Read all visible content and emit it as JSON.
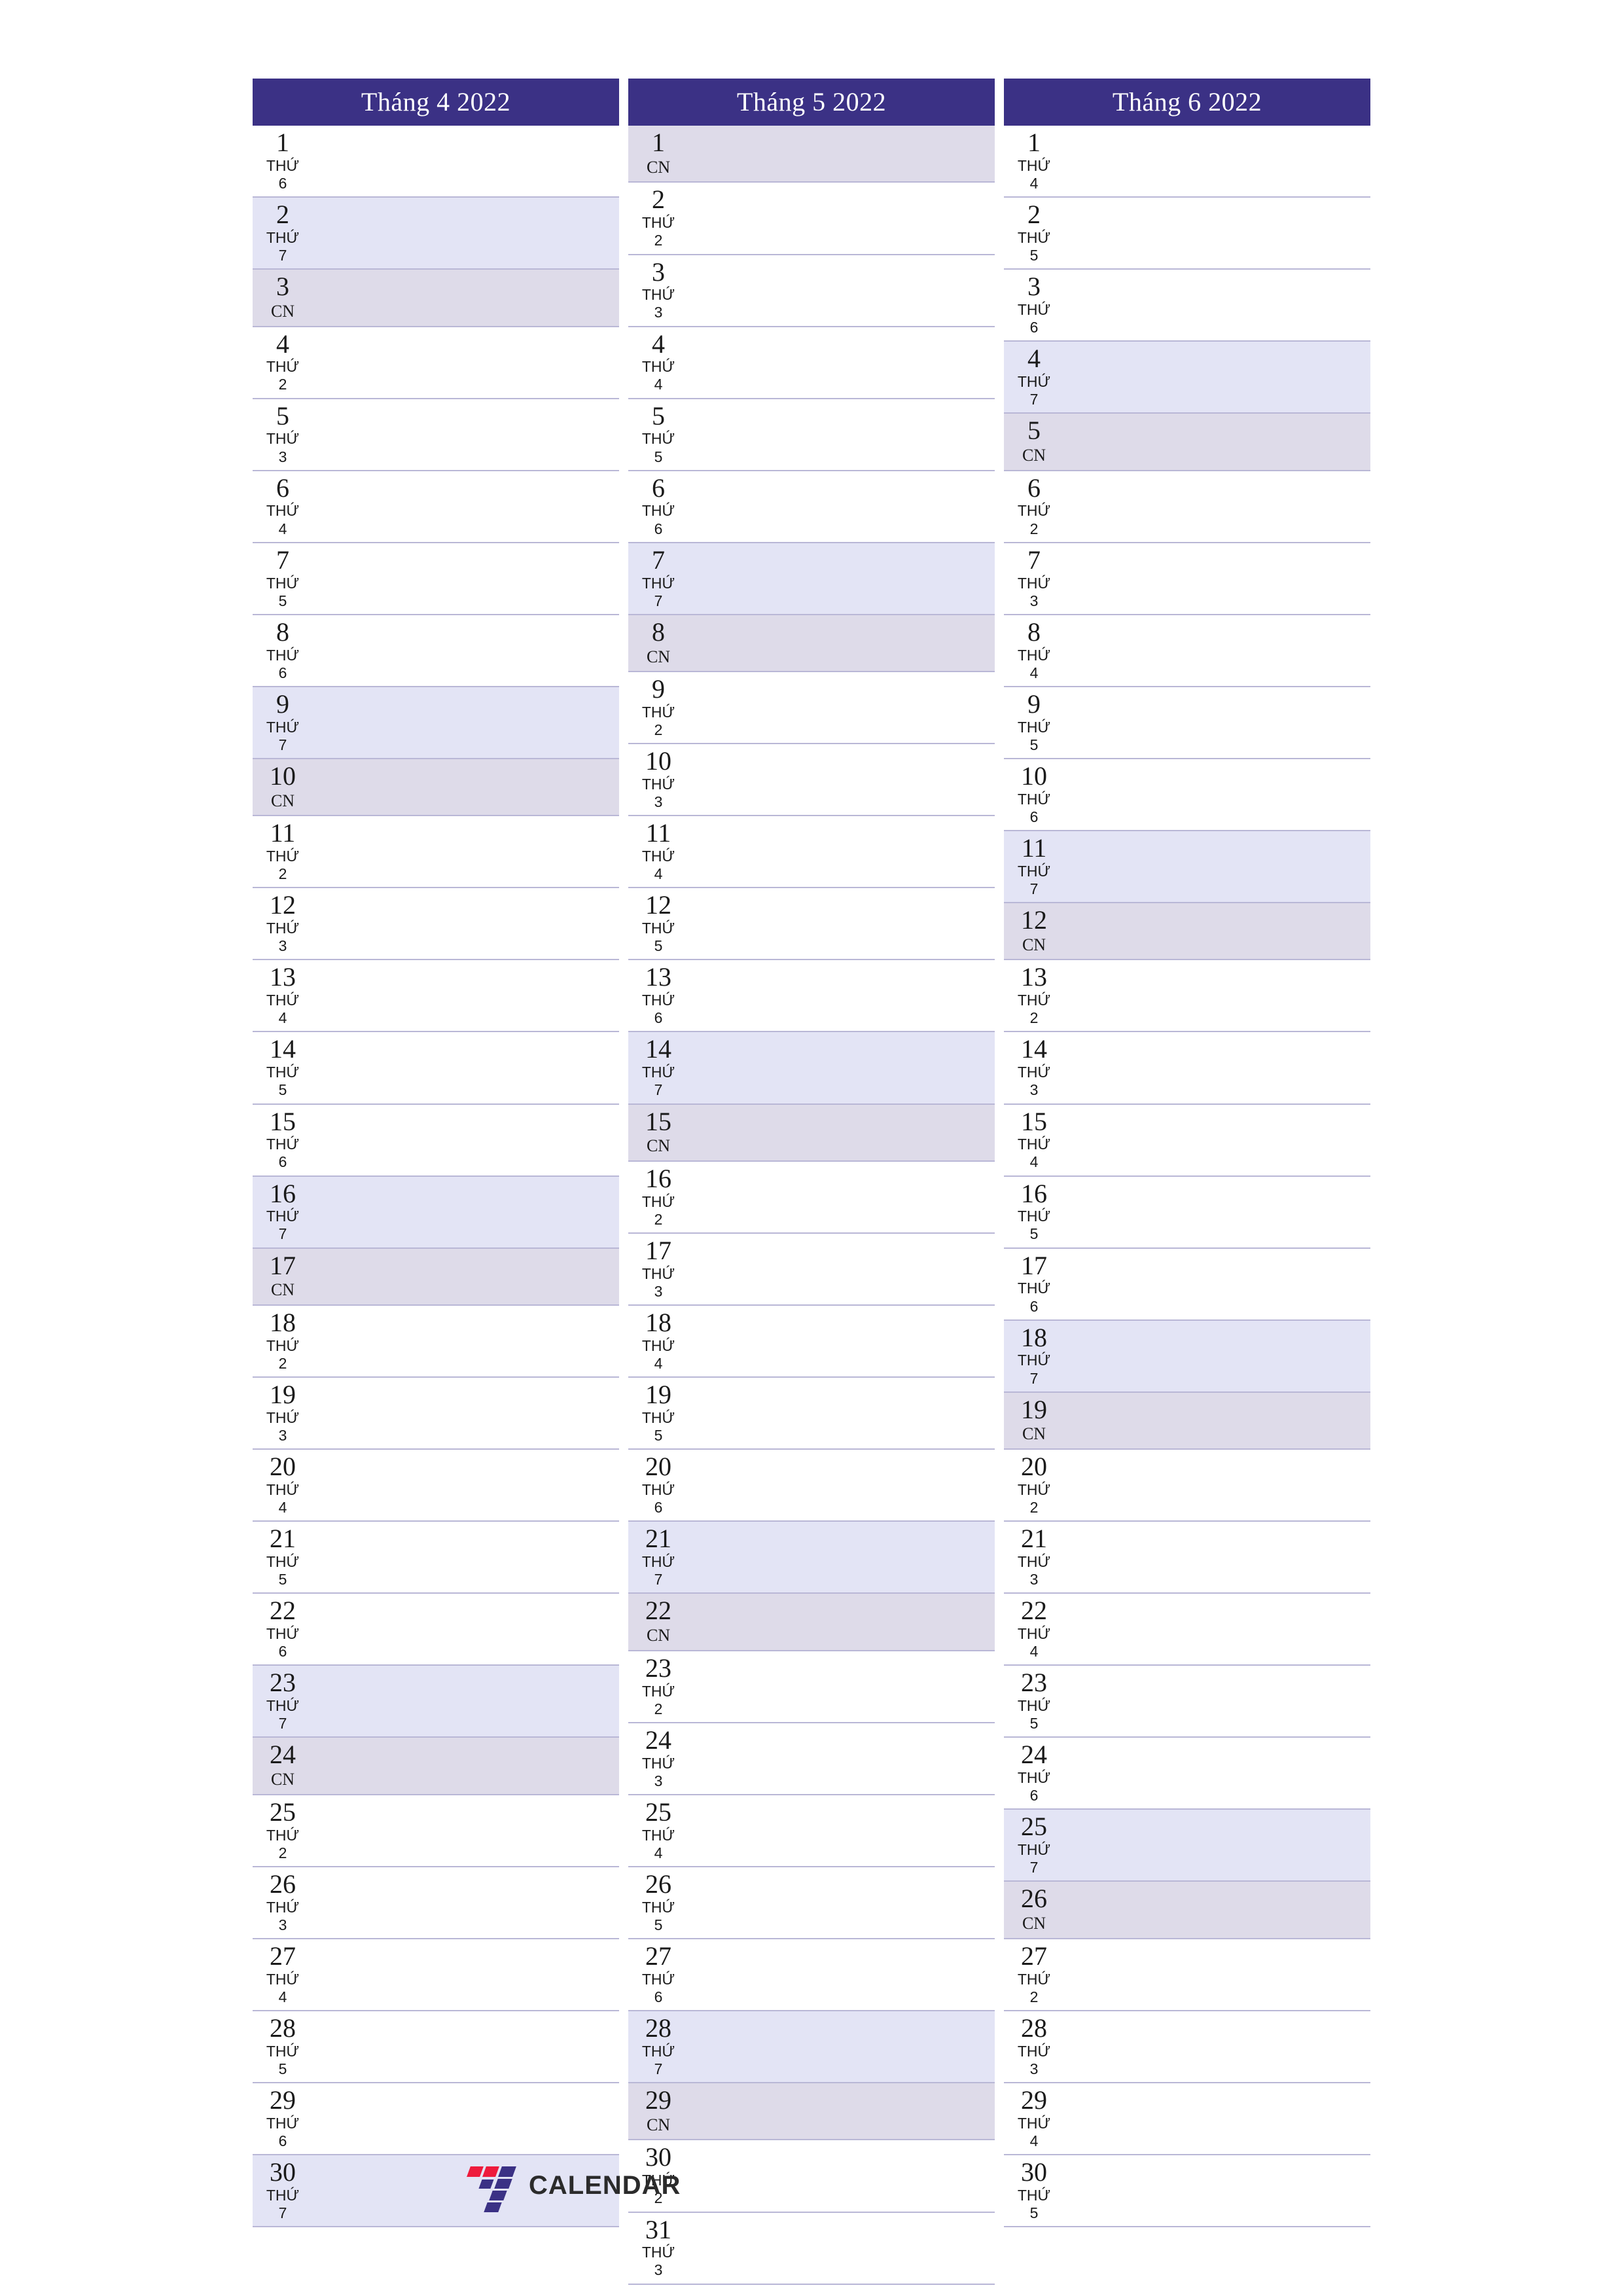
{
  "document": {
    "type": "quarterly-planner",
    "year": "2022",
    "weekend_colors": {
      "saturday": "#e3e4f5",
      "sunday": "#dedbe9"
    },
    "header_color": "#3b3185",
    "border_color": "#b9b7d6"
  },
  "brand": {
    "name": "CALENDAR",
    "mark": "seven-logo",
    "mark_colors": {
      "red": "#ee1b3c",
      "blue": "#3b3185"
    }
  },
  "months": [
    {
      "title": "Tháng 4 2022",
      "days": [
        {
          "num": "1",
          "name": "THỨ 6",
          "kind": "weekday"
        },
        {
          "num": "2",
          "name": "THỨ 7",
          "kind": "saturday"
        },
        {
          "num": "3",
          "name": "CN",
          "kind": "sunday"
        },
        {
          "num": "4",
          "name": "THỨ 2",
          "kind": "weekday"
        },
        {
          "num": "5",
          "name": "THỨ 3",
          "kind": "weekday"
        },
        {
          "num": "6",
          "name": "THỨ 4",
          "kind": "weekday"
        },
        {
          "num": "7",
          "name": "THỨ 5",
          "kind": "weekday"
        },
        {
          "num": "8",
          "name": "THỨ 6",
          "kind": "weekday"
        },
        {
          "num": "9",
          "name": "THỨ 7",
          "kind": "saturday"
        },
        {
          "num": "10",
          "name": "CN",
          "kind": "sunday"
        },
        {
          "num": "11",
          "name": "THỨ 2",
          "kind": "weekday"
        },
        {
          "num": "12",
          "name": "THỨ 3",
          "kind": "weekday"
        },
        {
          "num": "13",
          "name": "THỨ 4",
          "kind": "weekday"
        },
        {
          "num": "14",
          "name": "THỨ 5",
          "kind": "weekday"
        },
        {
          "num": "15",
          "name": "THỨ 6",
          "kind": "weekday"
        },
        {
          "num": "16",
          "name": "THỨ 7",
          "kind": "saturday"
        },
        {
          "num": "17",
          "name": "CN",
          "kind": "sunday"
        },
        {
          "num": "18",
          "name": "THỨ 2",
          "kind": "weekday"
        },
        {
          "num": "19",
          "name": "THỨ 3",
          "kind": "weekday"
        },
        {
          "num": "20",
          "name": "THỨ 4",
          "kind": "weekday"
        },
        {
          "num": "21",
          "name": "THỨ 5",
          "kind": "weekday"
        },
        {
          "num": "22",
          "name": "THỨ 6",
          "kind": "weekday"
        },
        {
          "num": "23",
          "name": "THỨ 7",
          "kind": "saturday"
        },
        {
          "num": "24",
          "name": "CN",
          "kind": "sunday"
        },
        {
          "num": "25",
          "name": "THỨ 2",
          "kind": "weekday"
        },
        {
          "num": "26",
          "name": "THỨ 3",
          "kind": "weekday"
        },
        {
          "num": "27",
          "name": "THỨ 4",
          "kind": "weekday"
        },
        {
          "num": "28",
          "name": "THỨ 5",
          "kind": "weekday"
        },
        {
          "num": "29",
          "name": "THỨ 6",
          "kind": "weekday"
        },
        {
          "num": "30",
          "name": "THỨ 7",
          "kind": "saturday"
        }
      ]
    },
    {
      "title": "Tháng 5 2022",
      "days": [
        {
          "num": "1",
          "name": "CN",
          "kind": "sunday"
        },
        {
          "num": "2",
          "name": "THỨ 2",
          "kind": "weekday"
        },
        {
          "num": "3",
          "name": "THỨ 3",
          "kind": "weekday"
        },
        {
          "num": "4",
          "name": "THỨ 4",
          "kind": "weekday"
        },
        {
          "num": "5",
          "name": "THỨ 5",
          "kind": "weekday"
        },
        {
          "num": "6",
          "name": "THỨ 6",
          "kind": "weekday"
        },
        {
          "num": "7",
          "name": "THỨ 7",
          "kind": "saturday"
        },
        {
          "num": "8",
          "name": "CN",
          "kind": "sunday"
        },
        {
          "num": "9",
          "name": "THỨ 2",
          "kind": "weekday"
        },
        {
          "num": "10",
          "name": "THỨ 3",
          "kind": "weekday"
        },
        {
          "num": "11",
          "name": "THỨ 4",
          "kind": "weekday"
        },
        {
          "num": "12",
          "name": "THỨ 5",
          "kind": "weekday"
        },
        {
          "num": "13",
          "name": "THỨ 6",
          "kind": "weekday"
        },
        {
          "num": "14",
          "name": "THỨ 7",
          "kind": "saturday"
        },
        {
          "num": "15",
          "name": "CN",
          "kind": "sunday"
        },
        {
          "num": "16",
          "name": "THỨ 2",
          "kind": "weekday"
        },
        {
          "num": "17",
          "name": "THỨ 3",
          "kind": "weekday"
        },
        {
          "num": "18",
          "name": "THỨ 4",
          "kind": "weekday"
        },
        {
          "num": "19",
          "name": "THỨ 5",
          "kind": "weekday"
        },
        {
          "num": "20",
          "name": "THỨ 6",
          "kind": "weekday"
        },
        {
          "num": "21",
          "name": "THỨ 7",
          "kind": "saturday"
        },
        {
          "num": "22",
          "name": "CN",
          "kind": "sunday"
        },
        {
          "num": "23",
          "name": "THỨ 2",
          "kind": "weekday"
        },
        {
          "num": "24",
          "name": "THỨ 3",
          "kind": "weekday"
        },
        {
          "num": "25",
          "name": "THỨ 4",
          "kind": "weekday"
        },
        {
          "num": "26",
          "name": "THỨ 5",
          "kind": "weekday"
        },
        {
          "num": "27",
          "name": "THỨ 6",
          "kind": "weekday"
        },
        {
          "num": "28",
          "name": "THỨ 7",
          "kind": "saturday"
        },
        {
          "num": "29",
          "name": "CN",
          "kind": "sunday"
        },
        {
          "num": "30",
          "name": "THỨ 2",
          "kind": "weekday"
        },
        {
          "num": "31",
          "name": "THỨ 3",
          "kind": "weekday"
        }
      ]
    },
    {
      "title": "Tháng 6 2022",
      "days": [
        {
          "num": "1",
          "name": "THỨ 4",
          "kind": "weekday"
        },
        {
          "num": "2",
          "name": "THỨ 5",
          "kind": "weekday"
        },
        {
          "num": "3",
          "name": "THỨ 6",
          "kind": "weekday"
        },
        {
          "num": "4",
          "name": "THỨ 7",
          "kind": "saturday"
        },
        {
          "num": "5",
          "name": "CN",
          "kind": "sunday"
        },
        {
          "num": "6",
          "name": "THỨ 2",
          "kind": "weekday"
        },
        {
          "num": "7",
          "name": "THỨ 3",
          "kind": "weekday"
        },
        {
          "num": "8",
          "name": "THỨ 4",
          "kind": "weekday"
        },
        {
          "num": "9",
          "name": "THỨ 5",
          "kind": "weekday"
        },
        {
          "num": "10",
          "name": "THỨ 6",
          "kind": "weekday"
        },
        {
          "num": "11",
          "name": "THỨ 7",
          "kind": "saturday"
        },
        {
          "num": "12",
          "name": "CN",
          "kind": "sunday"
        },
        {
          "num": "13",
          "name": "THỨ 2",
          "kind": "weekday"
        },
        {
          "num": "14",
          "name": "THỨ 3",
          "kind": "weekday"
        },
        {
          "num": "15",
          "name": "THỨ 4",
          "kind": "weekday"
        },
        {
          "num": "16",
          "name": "THỨ 5",
          "kind": "weekday"
        },
        {
          "num": "17",
          "name": "THỨ 6",
          "kind": "weekday"
        },
        {
          "num": "18",
          "name": "THỨ 7",
          "kind": "saturday"
        },
        {
          "num": "19",
          "name": "CN",
          "kind": "sunday"
        },
        {
          "num": "20",
          "name": "THỨ 2",
          "kind": "weekday"
        },
        {
          "num": "21",
          "name": "THỨ 3",
          "kind": "weekday"
        },
        {
          "num": "22",
          "name": "THỨ 4",
          "kind": "weekday"
        },
        {
          "num": "23",
          "name": "THỨ 5",
          "kind": "weekday"
        },
        {
          "num": "24",
          "name": "THỨ 6",
          "kind": "weekday"
        },
        {
          "num": "25",
          "name": "THỨ 7",
          "kind": "saturday"
        },
        {
          "num": "26",
          "name": "CN",
          "kind": "sunday"
        },
        {
          "num": "27",
          "name": "THỨ 2",
          "kind": "weekday"
        },
        {
          "num": "28",
          "name": "THỨ 3",
          "kind": "weekday"
        },
        {
          "num": "29",
          "name": "THỨ 4",
          "kind": "weekday"
        },
        {
          "num": "30",
          "name": "THỨ 5",
          "kind": "weekday"
        }
      ]
    }
  ]
}
